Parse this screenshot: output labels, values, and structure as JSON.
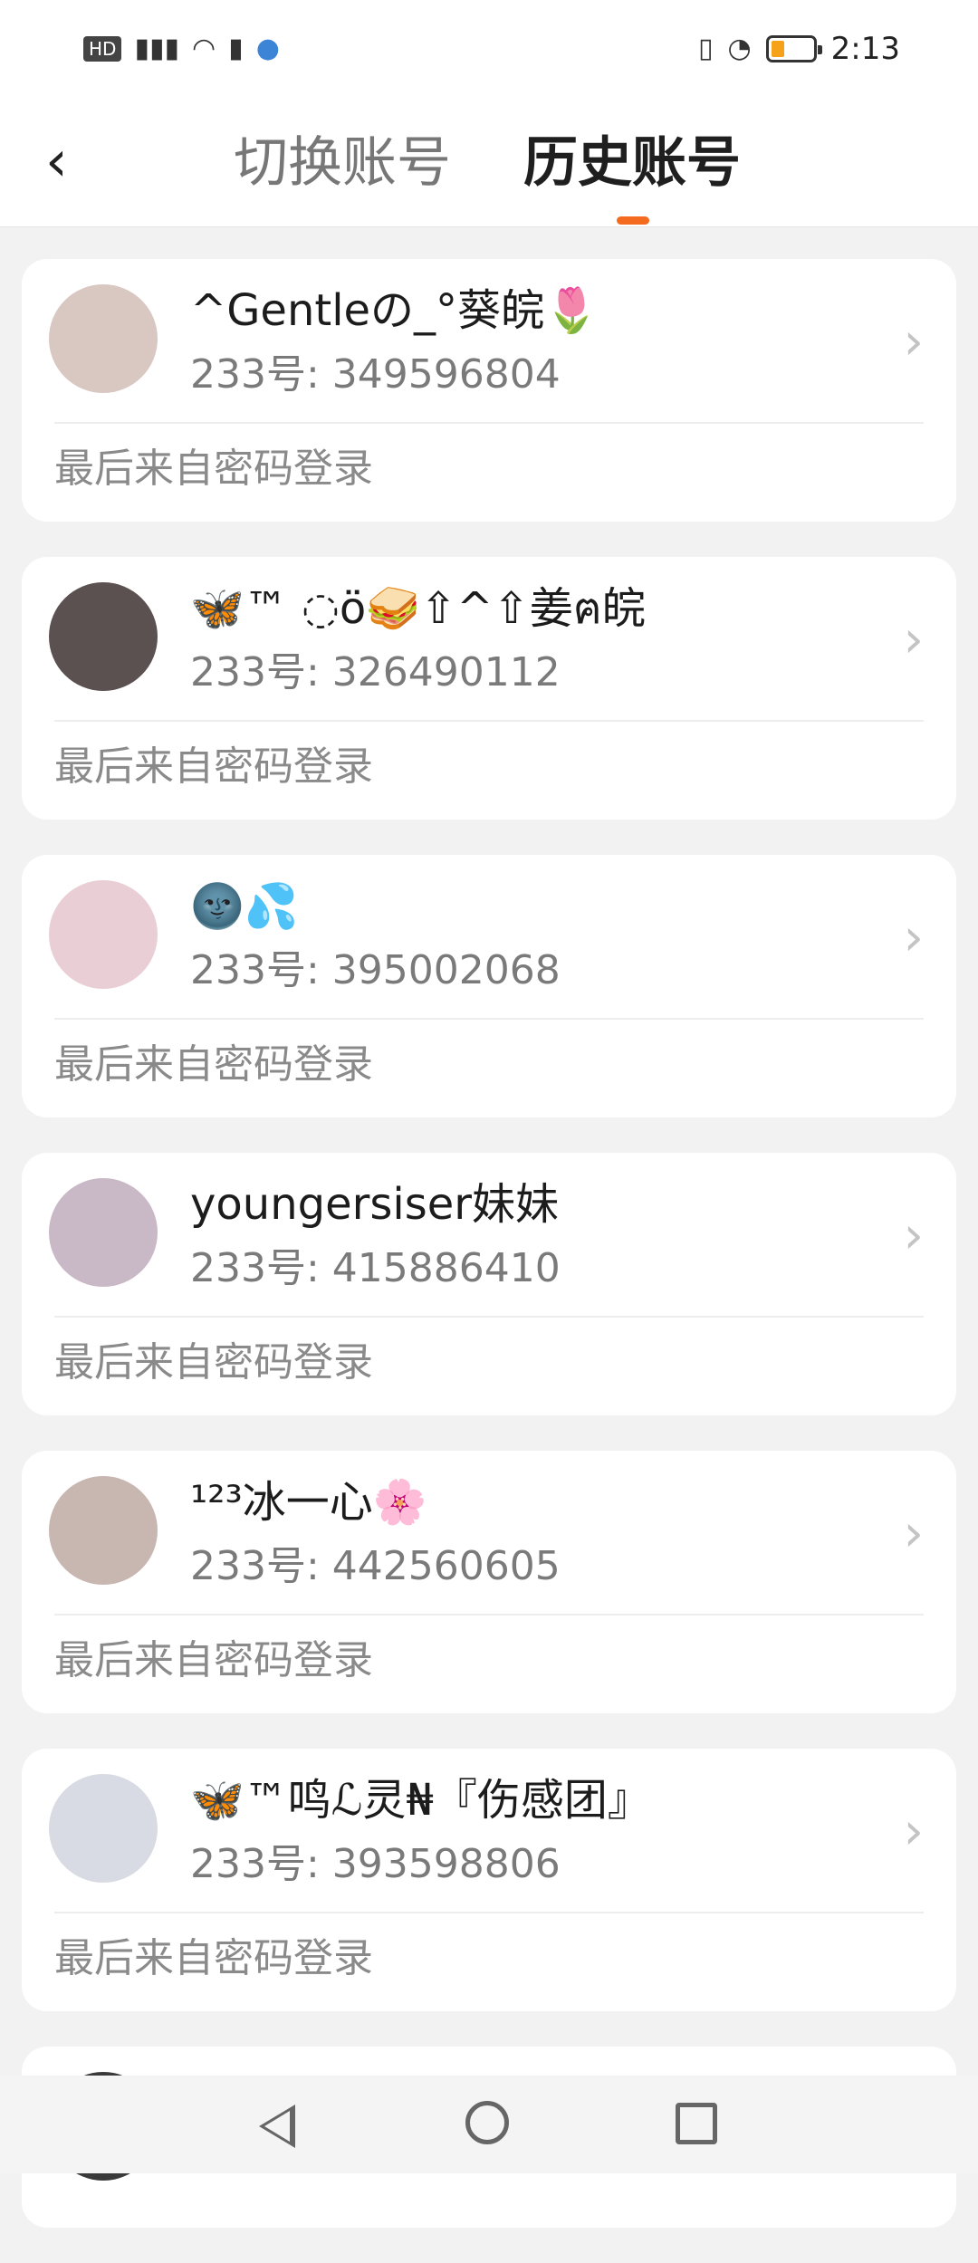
{
  "status_bar": {
    "left_icons": [
      "hd-badge-icon",
      "signal-4g-icon",
      "wifi-icon",
      "battery-warning-icon",
      "planet-icon"
    ],
    "hd_text": "HD",
    "time": "2:13",
    "right_icons": [
      "vibrate-icon",
      "speedometer-icon",
      "battery-icon"
    ]
  },
  "header": {
    "tabs": [
      {
        "label": "切换账号",
        "active": false
      },
      {
        "label": "历史账号",
        "active": true
      }
    ],
    "accent_color": "#f46a1e"
  },
  "accounts": [
    {
      "name": "^Gentleの_°葵皖🌷",
      "uid": "233号: 349596804",
      "source": "最后来自密码登录",
      "avatar_color": "#d9c7c2"
    },
    {
      "name": "🦋™ ◌ö🥪⇧^⇧姜ฅ皖",
      "uid": "233号: 326490112",
      "source": "最后来自密码登录",
      "avatar_color": "#5b5150"
    },
    {
      "name": "🌚💦",
      "uid": "233号: 395002068",
      "source": "最后来自密码登录",
      "avatar_color": "#e9cfd5"
    },
    {
      "name": "youngersiser妹妹",
      "uid": "233号: 415886410",
      "source": "最后来自密码登录",
      "avatar_color": "#c9b9c6"
    },
    {
      "name": "¹²³冰一心🌸",
      "uid": "233号: 442560605",
      "source": "最后来自密码登录",
      "avatar_color": "#c8b6b1"
    },
    {
      "name": "🦋™鸣ℒ灵₦『伤感团』",
      "uid": "233号: 393598806",
      "source": "最后来自密码登录",
      "avatar_color": "#d8dbe3"
    }
  ]
}
